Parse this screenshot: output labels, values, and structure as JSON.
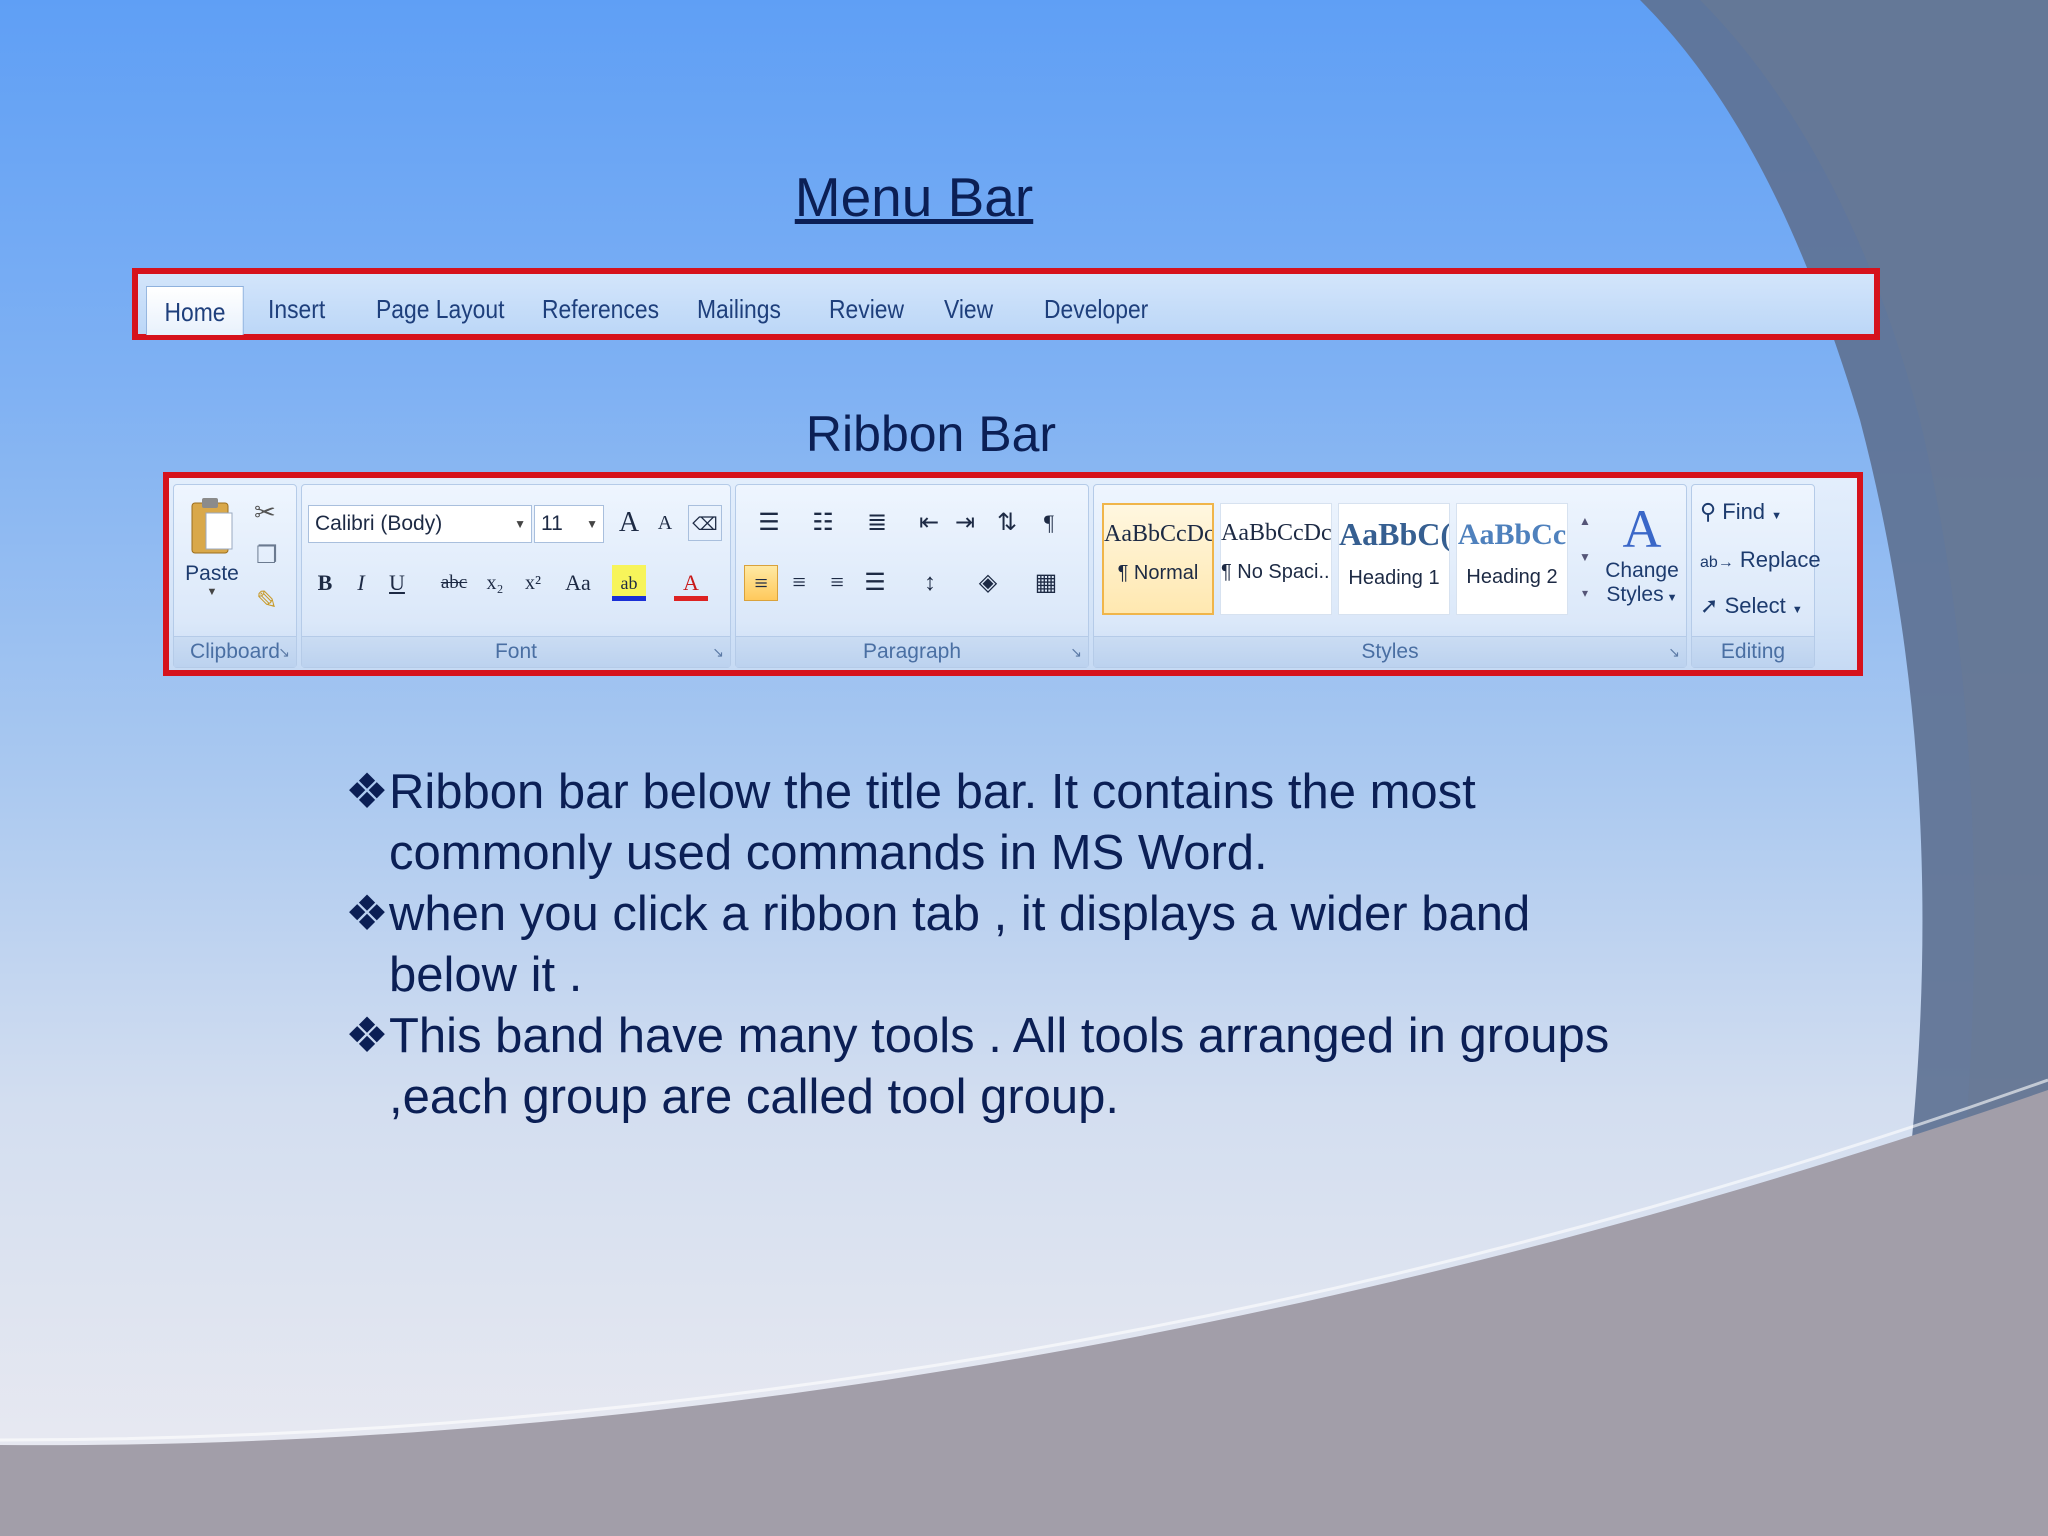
{
  "title": "Menu Bar",
  "ribbon_title": "Ribbon Bar",
  "menu_tabs": [
    "Home",
    "Insert",
    "Page Layout",
    "References",
    "Mailings",
    "Review",
    "View",
    "Developer"
  ],
  "ribbon": {
    "clipboard": {
      "paste": "Paste",
      "label": "Clipboard"
    },
    "font": {
      "font_name": "Calibri (Body)",
      "font_size": "11",
      "label": "Font",
      "grow": "A",
      "shrink": "A",
      "bold": "B",
      "italic": "I",
      "underline": "U",
      "strike": "abc",
      "subscript": "x₂",
      "superscript": "x²",
      "change_case": "Aa",
      "highlight": "ab",
      "font_color": "A"
    },
    "paragraph": {
      "label": "Paragraph",
      "pilcrow": "¶"
    },
    "styles": {
      "label": "Styles",
      "items": [
        {
          "sample": "AaBbCcDc",
          "name": "¶ Normal"
        },
        {
          "sample": "AaBbCcDc",
          "name": "¶ No Spaci..."
        },
        {
          "sample": "AaBbC(",
          "name": "Heading 1"
        },
        {
          "sample": "AaBbCc",
          "name": "Heading 2"
        }
      ],
      "change_styles_line1": "Change",
      "change_styles_line2": "Styles"
    },
    "editing": {
      "find": "Find",
      "replace": "Replace",
      "select": "Select",
      "label": "Editing"
    }
  },
  "bullets": [
    {
      "marker": "❖",
      "text": "Ribbon bar below the title bar. It contains the most commonly used commands in MS Word."
    },
    {
      "marker": "❖ ",
      "text": "when you click a ribbon tab , it displays a wider band below it ."
    },
    {
      "marker": "❖ ",
      "text": "This band have many tools . All tools arranged in groups ,each group are called tool group."
    }
  ]
}
